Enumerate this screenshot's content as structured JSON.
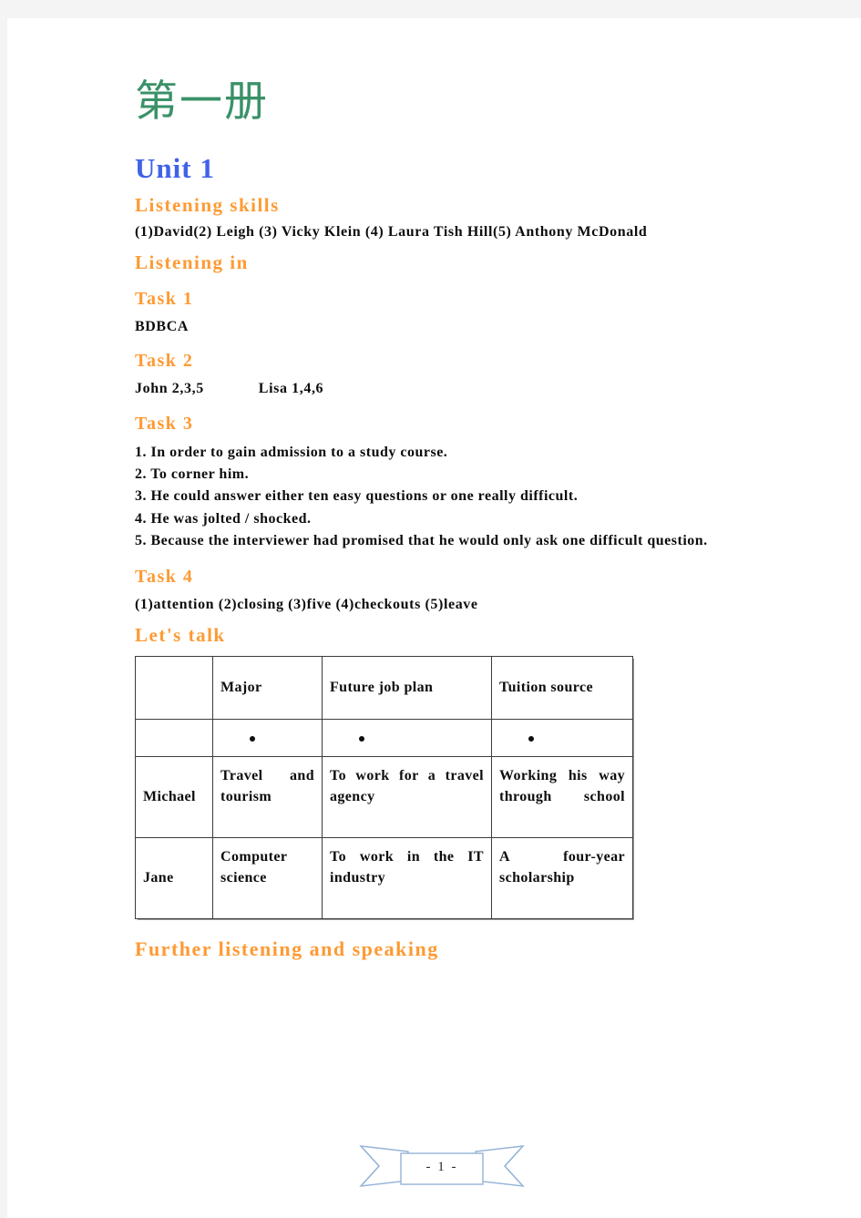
{
  "page": {
    "book_title": "第一册",
    "unit_title": "Unit 1",
    "page_number": "- 1 -"
  },
  "sections": {
    "listening_skills": {
      "heading": "Listening skills",
      "answer": "(1)David(2) Leigh (3) Vicky Klein (4) Laura Tish Hill(5) Anthony McDonald"
    },
    "listening_in": {
      "heading": "Listening in",
      "task1": {
        "heading": "Task 1",
        "answer": "BDBCA"
      },
      "task2": {
        "heading": "Task 2",
        "left": "John 2,3,5",
        "right": "Lisa 1,4,6"
      },
      "task3": {
        "heading": "Task 3",
        "items": [
          "1. In order to gain admission to a study course.",
          "2. To corner him.",
          "3. He could answer either ten easy questions or one really difficult.",
          "4. He was jolted / shocked.",
          "5. Because the interviewer had promised that he would only ask one difficult question."
        ]
      },
      "task4": {
        "heading": "Task 4",
        "answer": "(1)attention (2)closing (3)five (4)checkouts (5)leave"
      }
    },
    "lets_talk": {
      "heading": "Let's talk",
      "table": {
        "headers": [
          "",
          "Major",
          "Future job plan",
          "Tuition source"
        ],
        "bullet_row": [
          "",
          "•",
          "•",
          "•"
        ],
        "rows": [
          {
            "name": "Michael",
            "major": "Travel and tourism",
            "job": "To work for a travel agency",
            "tuition": "Working his way through school"
          },
          {
            "name": "Jane",
            "major": "Computer science",
            "job": "To work in the IT industry",
            "tuition": "A four-year scholarship"
          }
        ]
      }
    },
    "further": {
      "heading": "Further listening and speaking"
    }
  },
  "colors": {
    "title_green": "#3a9168",
    "unit_blue": "#4162e8",
    "heading_orange": "#fe9a33",
    "body_black": "#0d0d0d",
    "ribbon_blue": "#95b3d7",
    "page_background": "#f4f4f4"
  }
}
